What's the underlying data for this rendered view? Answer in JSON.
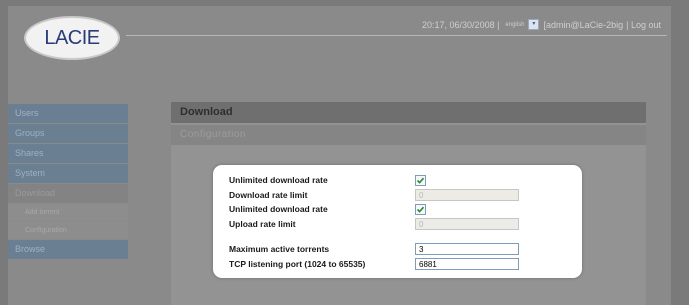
{
  "header": {
    "logo_text": "LACIE",
    "datetime": "20:17, 06/30/2008 |",
    "language": "english",
    "user": "[admin@LaCie-2big",
    "logout": "| Log out"
  },
  "sidebar": {
    "items": [
      {
        "label": "Users"
      },
      {
        "label": "Groups"
      },
      {
        "label": "Shares"
      },
      {
        "label": "System"
      },
      {
        "label": "Download"
      },
      {
        "label": "Browse"
      }
    ],
    "sub_items": [
      {
        "label": "Add torrent"
      },
      {
        "label": "Configuration"
      }
    ]
  },
  "main": {
    "title": "Download",
    "subtitle": "Configuration"
  },
  "form": {
    "unlimited_download_label": "Unlimited download rate",
    "unlimited_download_checked": true,
    "download_limit_label": "Download rate limit",
    "download_limit_value": "0",
    "unlimited_upload_label": "Unlimited download rate",
    "unlimited_upload_checked": true,
    "upload_limit_label": "Upload rate limit",
    "upload_limit_value": "0",
    "max_torrents_label": "Maximum active torrents",
    "max_torrents_value": "3",
    "tcp_port_label": "TCP listening port (1024 to 65535)",
    "tcp_port_value": "6881"
  },
  "colors": {
    "nav_blue": "#6b7f93",
    "panel_bg": "#ffffff",
    "checkbox_check": "#2a8a2a"
  }
}
